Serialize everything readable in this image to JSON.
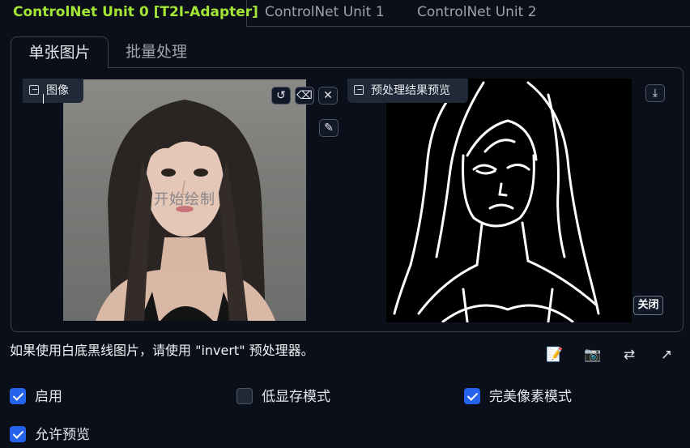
{
  "unit_tabs": [
    {
      "label": "ControlNet Unit 0 [T2I-Adapter]",
      "active": true
    },
    {
      "label": "ControlNet Unit 1",
      "active": false
    },
    {
      "label": "ControlNet Unit 2",
      "active": false
    }
  ],
  "mode_tabs": [
    {
      "label": "单张图片",
      "active": true
    },
    {
      "label": "批量处理",
      "active": false
    }
  ],
  "image_input": {
    "label": "图像",
    "overlay_text": "开始绘制",
    "buttons": {
      "reset": "↺",
      "erase": "⌫",
      "clear": "✕",
      "brush": "✎"
    }
  },
  "preview": {
    "label": "预处理结果预览",
    "download_icon": "⤓",
    "close_label": "关闭"
  },
  "hint": "如果使用白底黑线图片，请使用 \"invert\" 预处理器。",
  "tools": {
    "edit": "📝",
    "camera": "📷",
    "swap": "⇄",
    "send": "↗"
  },
  "checkboxes": [
    {
      "label": "启用",
      "checked": true
    },
    {
      "label": "低显存模式",
      "checked": false
    },
    {
      "label": "完美像素模式",
      "checked": true
    },
    {
      "label": "允许预览",
      "checked": true
    }
  ],
  "colors": {
    "accent": "#a3e635",
    "checkbox": "#2563eb",
    "background": "#0b0f19"
  }
}
